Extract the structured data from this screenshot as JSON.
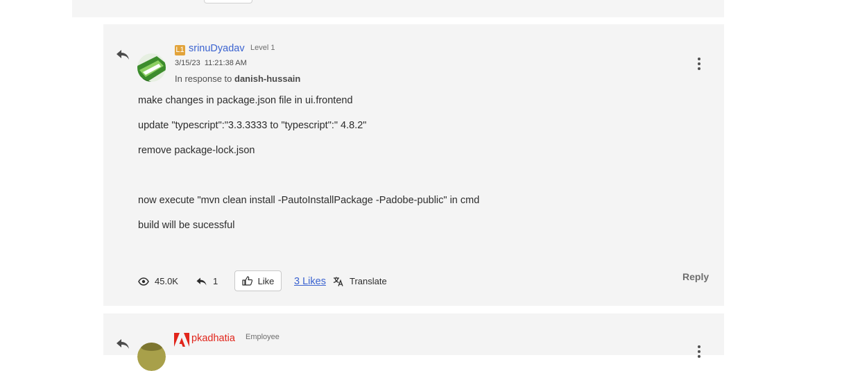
{
  "post": {
    "author": "srinuDyadav",
    "rank_badge": "L1",
    "level": "Level 1",
    "date": "3/15/23",
    "time": "11:21:38 AM",
    "in_response_prefix": "In response to",
    "in_response_to": "danish-hussain",
    "body": [
      "make changes in package.json file in ui.frontend",
      "update \"typescript\":\"3.3.3333 to \"typescript\":\" 4.8.2\"",
      "remove package-lock.json",
      "now execute \"mvn clean install -PautoInstallPackage -Padobe-public\" in cmd",
      "build will be sucessful"
    ],
    "views": "45.0K",
    "replies": "1",
    "like_label": "Like",
    "likes_link": "3 Likes",
    "translate_label": "Translate",
    "reply_label": "Reply"
  },
  "next_post": {
    "author": "pkadhatia",
    "role": "Employee"
  },
  "colors": {
    "link": "#3b63d0",
    "rank_badge": "#e2a33a",
    "adobe_red": "#e1251b",
    "card_bg": "#f4f4f4"
  },
  "icons": [
    "reply-arrow-icon",
    "more-options-icon",
    "eye-icon",
    "thumbs-up-icon",
    "translate-icon",
    "adobe-logo-icon"
  ]
}
